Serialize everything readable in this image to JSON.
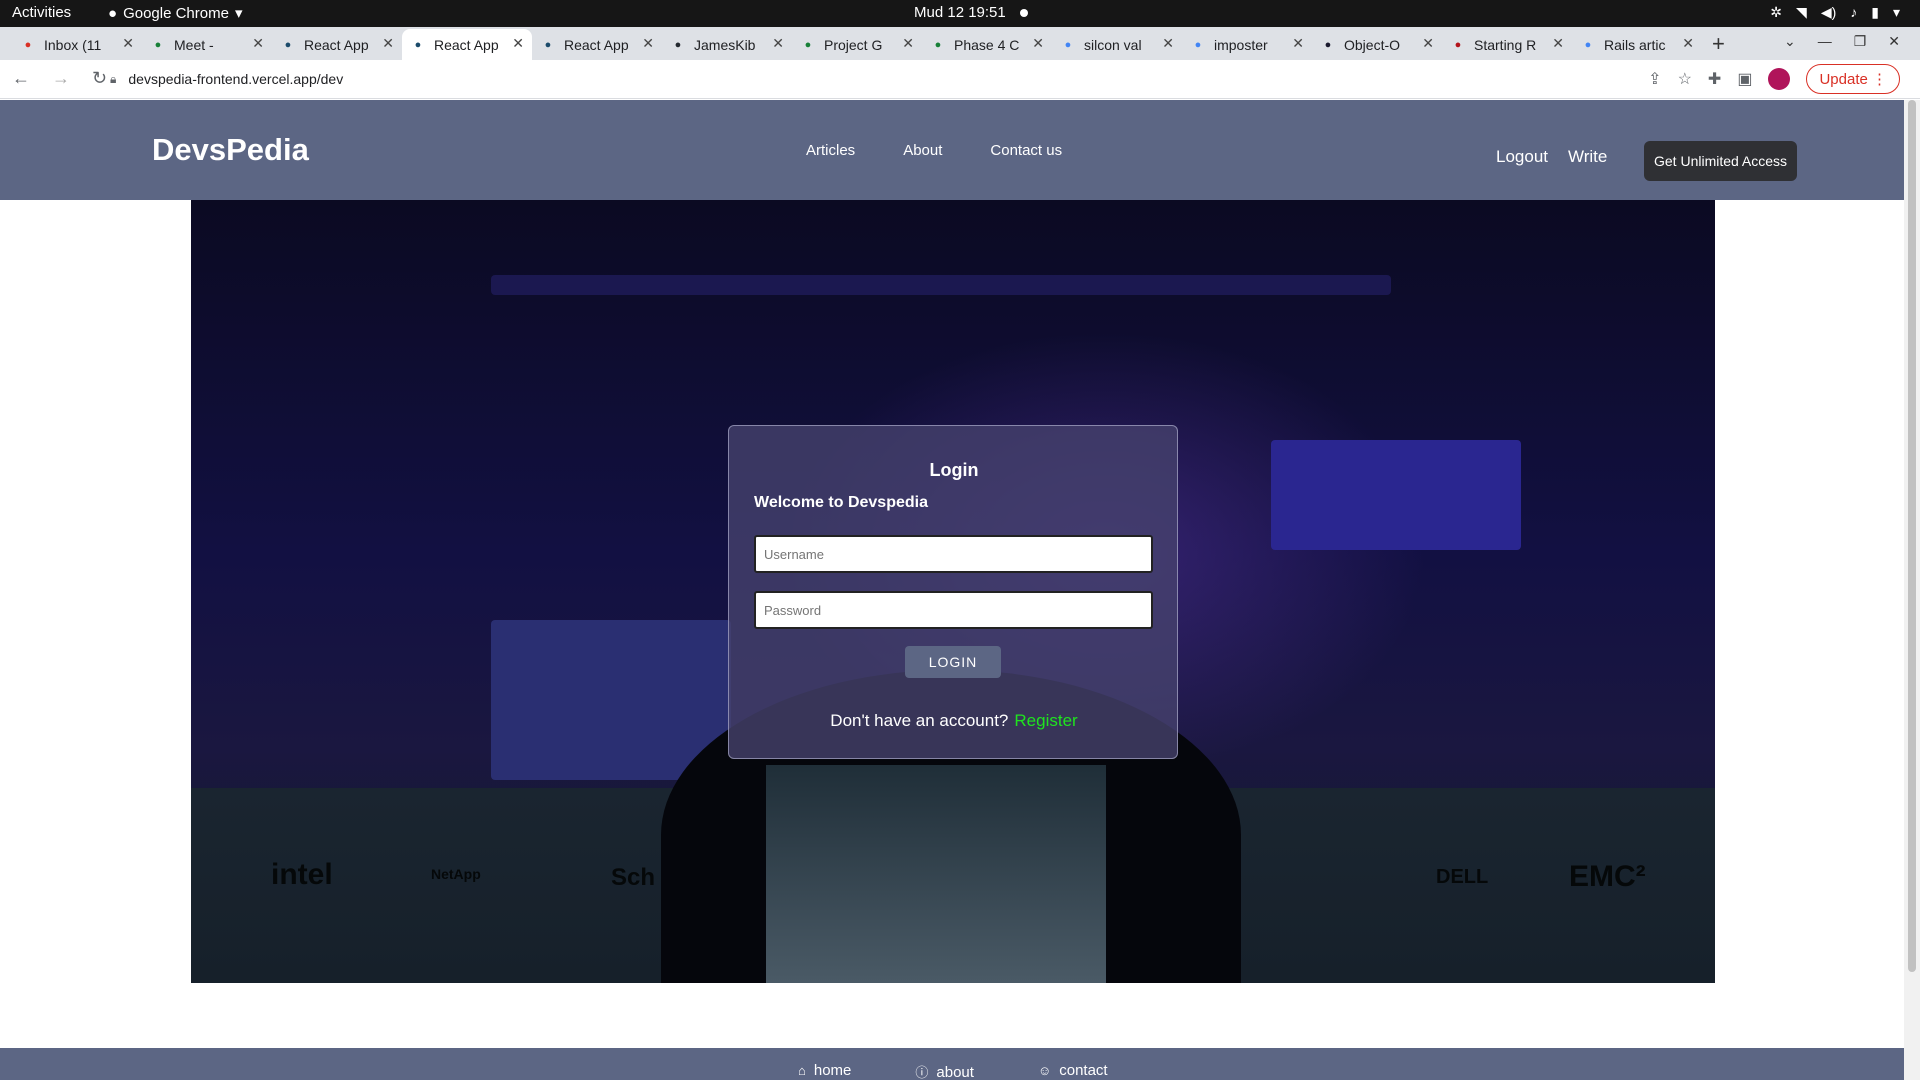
{
  "system": {
    "activities": "Activities",
    "app_name": "Google Chrome",
    "clock": "Mud 12  19:51"
  },
  "browser": {
    "tabs": [
      {
        "title": "Inbox (11",
        "favicon": "gmail-icon",
        "color": "#d93025"
      },
      {
        "title": "Meet -",
        "favicon": "meet-icon",
        "color": "#188038"
      },
      {
        "title": "React App",
        "favicon": "react-icon",
        "color": "#1b4b6b"
      },
      {
        "title": "React App",
        "favicon": "react-icon",
        "color": "#1b4b6b"
      },
      {
        "title": "React App",
        "favicon": "react-icon",
        "color": "#1b4b6b"
      },
      {
        "title": "JamesKib",
        "favicon": "github-icon",
        "color": "#24292f"
      },
      {
        "title": "Project G",
        "favicon": "sheets-icon",
        "color": "#188038"
      },
      {
        "title": "Phase 4 C",
        "favicon": "sheets-icon",
        "color": "#188038"
      },
      {
        "title": "silcon val",
        "favicon": "google-icon",
        "color": "#4285f4"
      },
      {
        "title": "imposter",
        "favicon": "google-icon",
        "color": "#4285f4"
      },
      {
        "title": "Object-O",
        "favicon": "a-icon",
        "color": "#1a1a2e"
      },
      {
        "title": "Starting R",
        "favicon": "be-icon",
        "color": "#b3131b"
      },
      {
        "title": "Rails artic",
        "favicon": "google-icon",
        "color": "#4285f4"
      }
    ],
    "active_tab": 3,
    "url": "devspedia-frontend.vercel.app/dev",
    "update_label": "Update"
  },
  "site": {
    "brand": "DevsPedia",
    "nav": [
      "Articles",
      "About",
      "Contact us"
    ],
    "logout": "Logout",
    "write": "Write",
    "cta": "Get Unlimited Access",
    "accent": "#5c6684"
  },
  "login": {
    "title": "Login",
    "welcome": "Welcome to Devspedia",
    "username_placeholder": "Username",
    "password_placeholder": "Password",
    "button": "LOGIN",
    "no_account": "Don't have an account?",
    "register": "Register"
  },
  "hero_logos": [
    "intel",
    "NetApp",
    "Sch",
    "DELL",
    "EMC²"
  ],
  "footer": {
    "home": "home",
    "about": "about",
    "contact": "contact"
  }
}
